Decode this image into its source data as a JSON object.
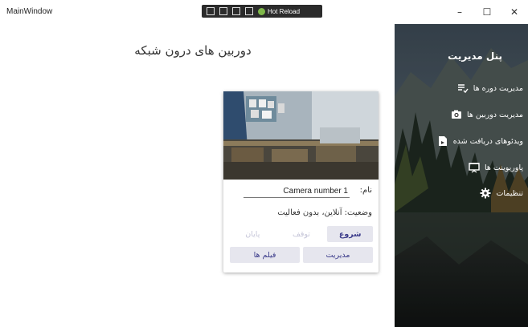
{
  "window": {
    "title": "MainWindow",
    "hot_reload_label": "Hot Reload",
    "controls": {
      "minimize": "–",
      "maximize": "☐",
      "close": "✕"
    }
  },
  "main": {
    "title": "دوربین های درون شبکه"
  },
  "camera_card": {
    "name_label": "نام:",
    "name_value": "Camera number 1",
    "status": "وضعیت: آنلاین، بدون فعالیت",
    "buttons": {
      "start": "شروع",
      "pause": "توقف",
      "stop": "پایان",
      "manage": "مدیریت",
      "films": "فیلم ها"
    }
  },
  "sidebar": {
    "title": "پنل مدیریت",
    "items": [
      {
        "label": "مدیریت دوره ها",
        "icon": "playlist-check-icon"
      },
      {
        "label": "مدیریت دوربین ها",
        "icon": "camera-icon"
      },
      {
        "label": "ویدئوهای دریافت شده",
        "icon": "video-file-icon"
      },
      {
        "label": "پاورپوینت ها",
        "icon": "presentation-icon"
      },
      {
        "label": "تنظیمات",
        "icon": "gear-icon"
      }
    ]
  },
  "colors": {
    "accent": "#3b3b8a",
    "button_bg": "#e6e6ee",
    "disabled_text": "#c5c5d8",
    "hot_reload_green": "#7fb84a"
  }
}
